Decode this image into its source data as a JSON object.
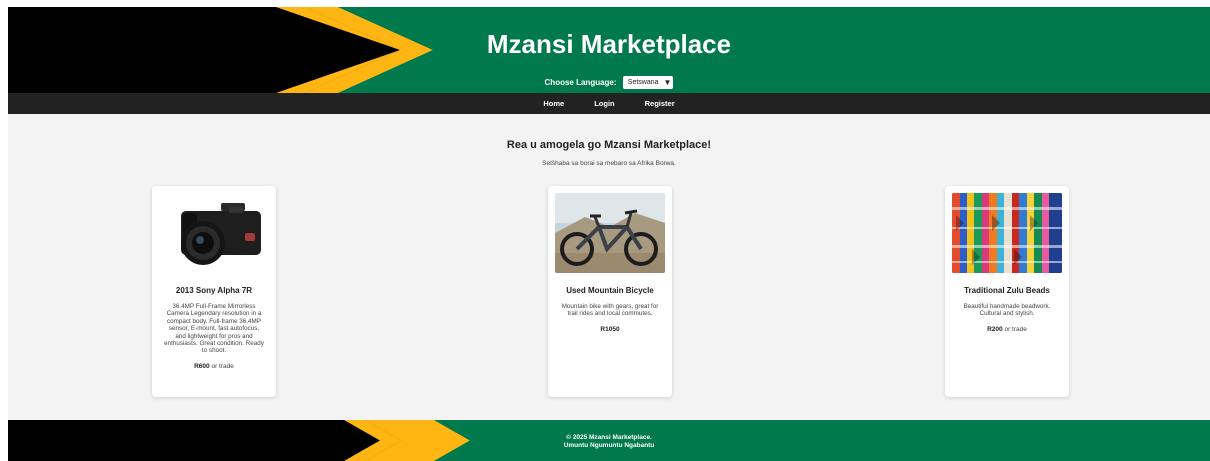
{
  "colors": {
    "green": "#007a4d",
    "black": "#000000",
    "gold": "#ffb612",
    "nav": "#222222",
    "main_bg": "#f3f3f3"
  },
  "header": {
    "title": "Mzansi Marketplace",
    "language_label": "Choose Language:",
    "language_selected": "Setswana"
  },
  "nav": {
    "home": "Home",
    "login": "Login",
    "register": "Register"
  },
  "main": {
    "welcome": "Rea u amogela go Mzansi Marketplace!",
    "tagline": "Setšhaba sa borai sa mebaro sa Afrika Borwa."
  },
  "products": [
    {
      "image_icon": "camera-image",
      "title": "2013 Sony Alpha 7R",
      "description": "36.4MP Full-Frame Mirrorless Camera Legendary resolution in a compact body. Full-frame 36.4MP sensor, E-mount, fast autofocus, and lightweight for pros and enthusiasts. Great condition. Ready to shoot.",
      "price": "R600",
      "price_suffix": "or trade"
    },
    {
      "image_icon": "bicycle-image",
      "title": "Used Mountain Bicycle",
      "description": "Mountain bike with gears, great for trail rides and local commutes.",
      "price": "R1050",
      "price_suffix": ""
    },
    {
      "image_icon": "beads-image",
      "title": "Traditional Zulu Beads",
      "description": "Beautiful handmade beadwork. Cultural and stylish.",
      "price": "R200",
      "price_suffix": "or trade"
    }
  ],
  "footer": {
    "copyright": "© 2025 Mzansi Marketplace.",
    "motto": "Umuntu Ngumuntu Ngabantu"
  }
}
